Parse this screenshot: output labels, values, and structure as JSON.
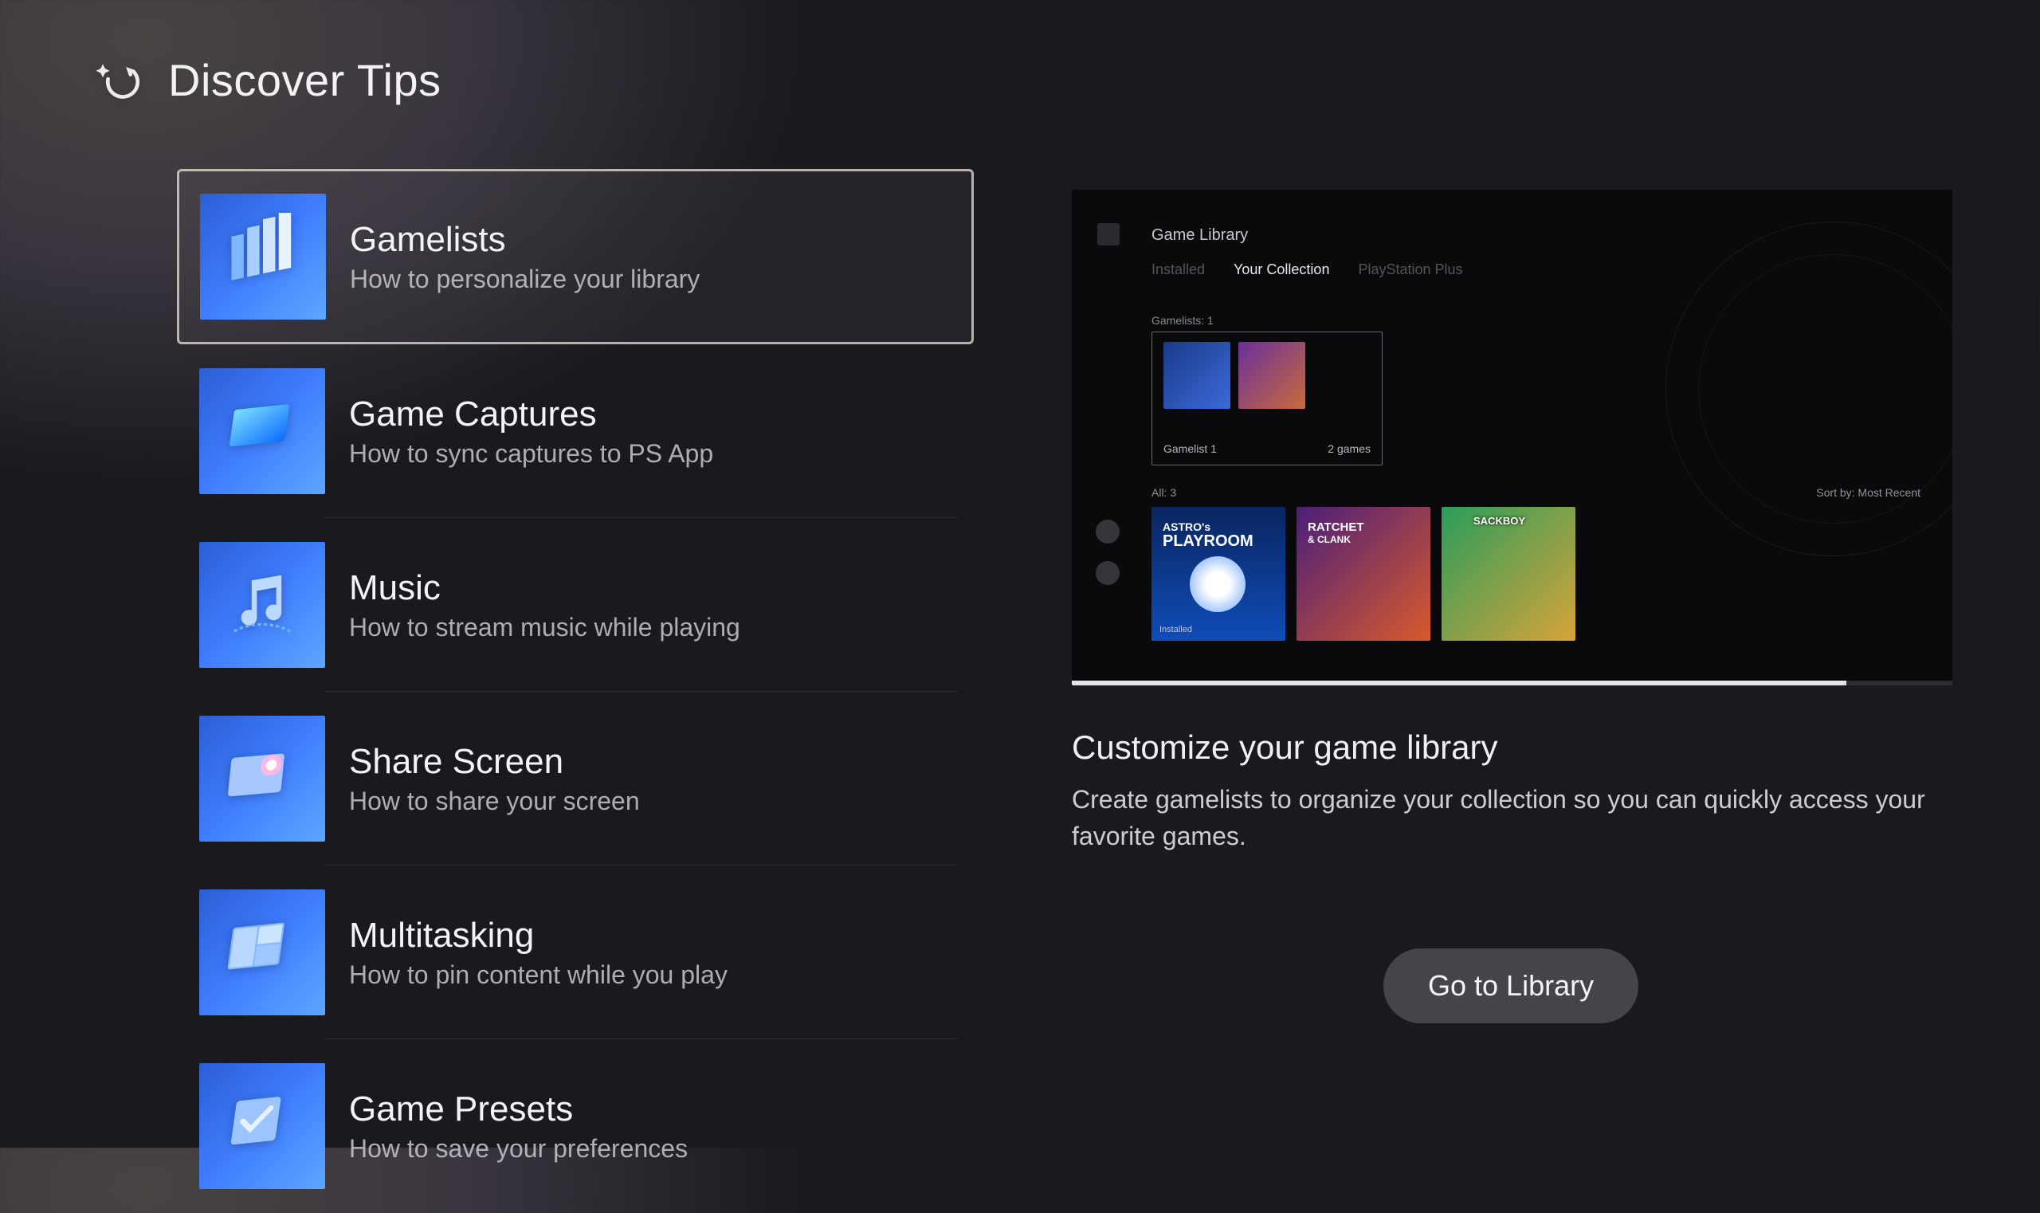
{
  "header": {
    "title": "Discover Tips"
  },
  "tips": [
    {
      "title": "Gamelists",
      "subtitle": "How to personalize your library",
      "selected": true
    },
    {
      "title": "Game Captures",
      "subtitle": "How to sync captures to PS App",
      "selected": false
    },
    {
      "title": "Music",
      "subtitle": "How to stream music while playing",
      "selected": false
    },
    {
      "title": "Share Screen",
      "subtitle": "How to share your screen",
      "selected": false
    },
    {
      "title": "Multitasking",
      "subtitle": "How to pin content while you play",
      "selected": false
    },
    {
      "title": "Game Presets",
      "subtitle": "How to save your preferences",
      "selected": false
    }
  ],
  "preview": {
    "app": "Game Library",
    "tabs": [
      "Installed",
      "Your Collection",
      "PlayStation Plus"
    ],
    "active_tab": 1,
    "gamelists_label": "Gamelists: 1",
    "gamelist": {
      "name": "Gamelist 1",
      "count_label": "2 games"
    },
    "all_label": "All: 3",
    "sort_label": "Sort by:  Most Recent",
    "games": [
      {
        "line1": "ASTRO's",
        "line2": "PLAYROOM",
        "installed_label": "Installed"
      },
      {
        "line1": "RATCHET",
        "line2": "& CLANK"
      },
      {
        "line1": "SACKBOY"
      }
    ]
  },
  "detail": {
    "heading": "Customize your game library",
    "body": "Create gamelists to organize your collection so you can quickly access your favorite games.",
    "cta": "Go to Library"
  }
}
